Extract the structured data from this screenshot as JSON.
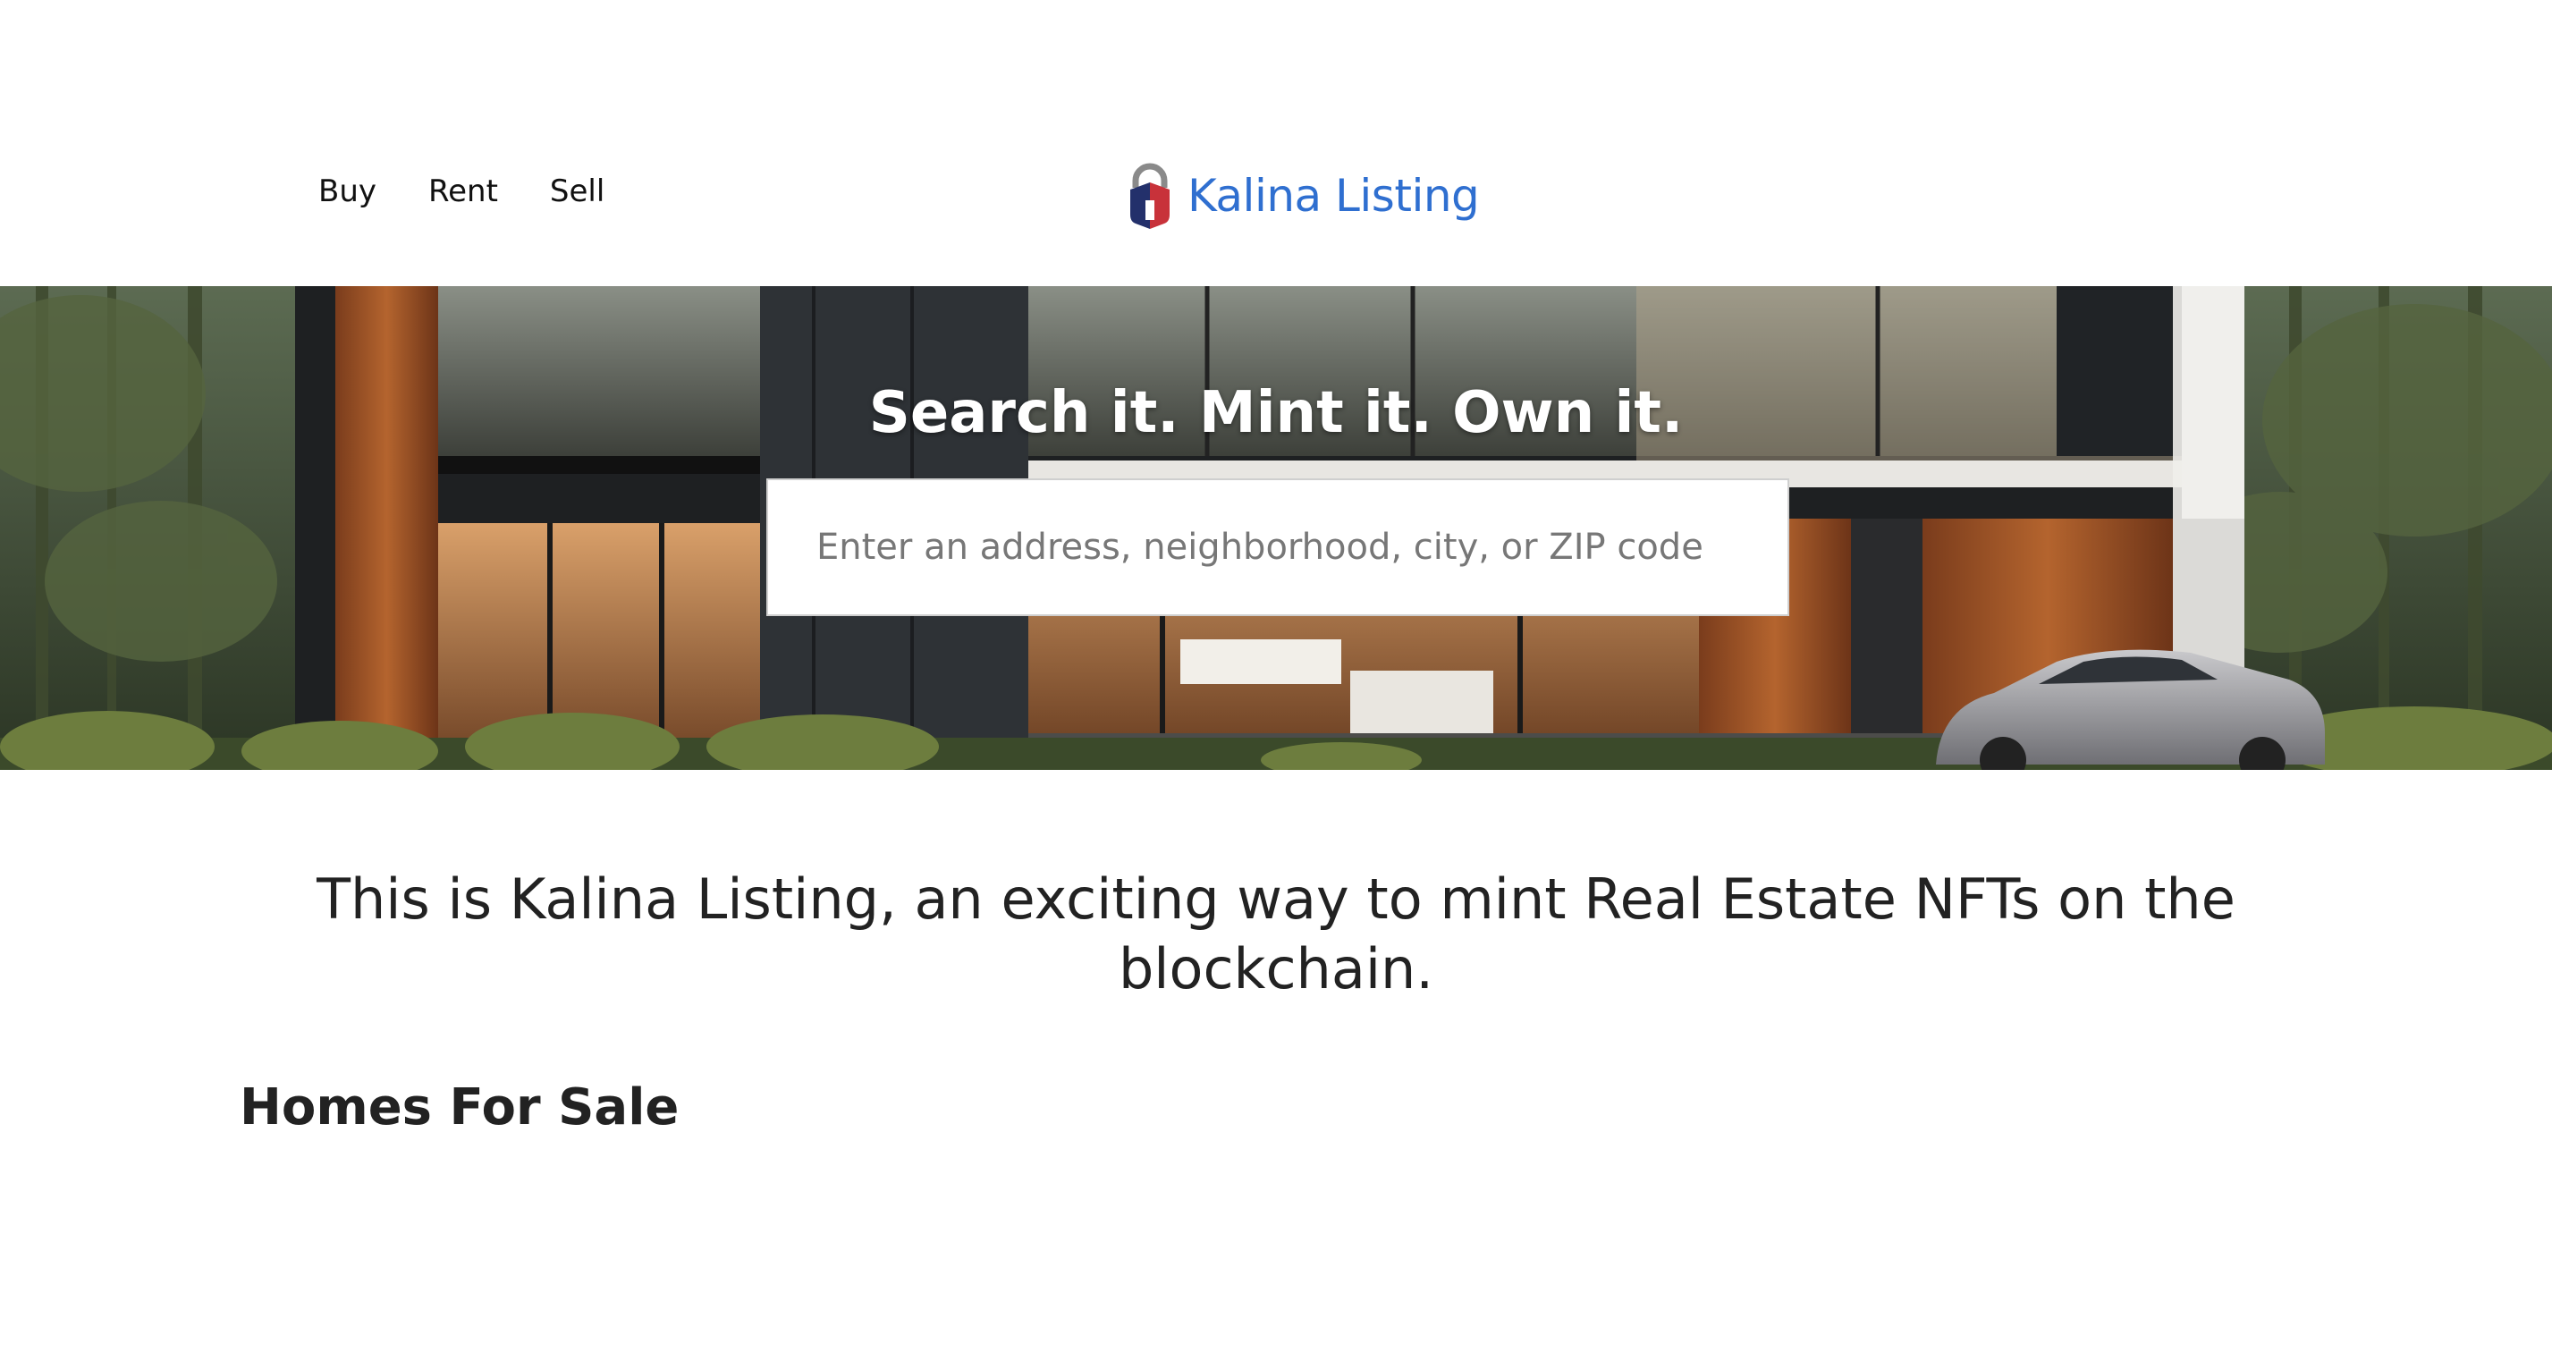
{
  "nav": {
    "items": [
      {
        "label": "Buy"
      },
      {
        "label": "Rent"
      },
      {
        "label": "Sell"
      }
    ]
  },
  "brand": {
    "name": "Kalina Listing",
    "logo_icon": "padlock-house-icon",
    "color": "#2f6fd0"
  },
  "hero": {
    "tagline": "Search it. Mint it. Own it.",
    "background_image": "modern-house-photo",
    "search": {
      "placeholder": "Enter an address, neighborhood, city, or ZIP code",
      "value": ""
    }
  },
  "intro": {
    "text": "This is Kalina Listing, an exciting way to mint Real Estate NFTs on the blockchain."
  },
  "listings": {
    "title": "Homes For Sale"
  }
}
